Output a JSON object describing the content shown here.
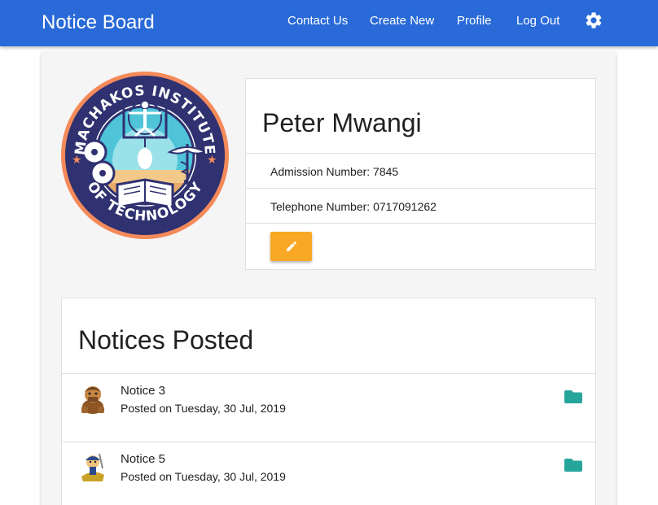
{
  "navbar": {
    "brand": "Notice Board",
    "links": [
      "Contact Us",
      "Create New",
      "Profile",
      "Log Out"
    ],
    "settings_icon": "gear-icon",
    "color": "#2a6ad8"
  },
  "logo": {
    "name": "MACHAKOS INSTITUTE OF TECHNOLOGY"
  },
  "profile": {
    "name": "Peter Mwangi",
    "admission": "Admission Number: 7845",
    "telephone": "Telephone Number: 0717091262",
    "edit_icon": "pencil-icon",
    "edit_color": "#f9a825"
  },
  "notices": {
    "title": "Notices Posted",
    "items": [
      {
        "title": "Notice 3",
        "date": "Posted on Tuesday, 30 Jul, 2019",
        "icon": "folder-icon"
      },
      {
        "title": "Notice 5",
        "date": "Posted on Tuesday, 30 Jul, 2019",
        "icon": "folder-icon"
      }
    ],
    "folder_color": "#26a69a"
  }
}
